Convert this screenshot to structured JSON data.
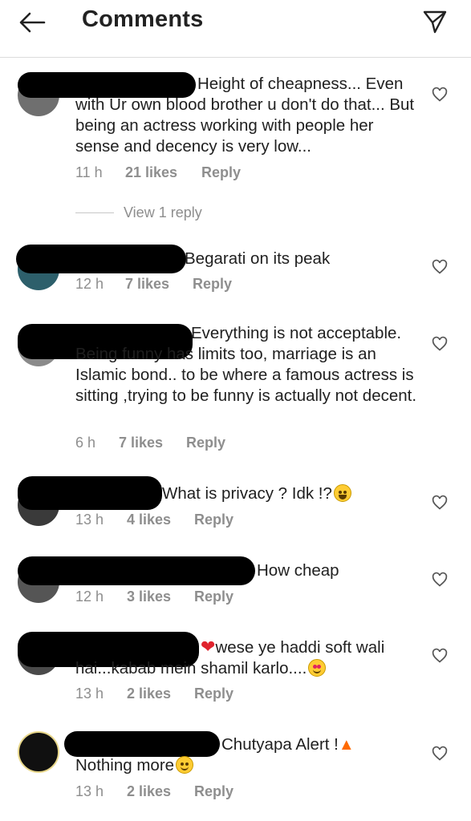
{
  "header": {
    "title": "Comments",
    "back_icon": "arrow-left-icon",
    "send_icon": "send-paper-plane-icon"
  },
  "comments": [
    {
      "text": "Height of cheapness... Even with Ur own blood brother u don't do that... But being an actress working with people her sense and decency is very low...",
      "time": "11 h",
      "likes": "21 likes",
      "reply": "Reply",
      "view_replies": "View 1 reply"
    },
    {
      "text": "Begarati on its peak",
      "time": "12 h",
      "likes": "7 likes",
      "reply": "Reply"
    },
    {
      "text": "Everything is not acceptable. Being funny has limits too, marriage is an Islamic bond.. to be where a famous actress is sitting ,trying to be funny is actually not decent.",
      "time": "6 h",
      "likes": "7 likes",
      "reply": "Reply"
    },
    {
      "text": "What is privacy ? Idk !?",
      "time": "13 h",
      "likes": "4 likes",
      "reply": "Reply"
    },
    {
      "text": "How cheap",
      "time": "12 h",
      "likes": "3 likes",
      "reply": "Reply"
    },
    {
      "text": "wese ye haddi soft wali hai...kabab mein shamil karlo....",
      "time": "13 h",
      "likes": "2 likes",
      "reply": "Reply"
    },
    {
      "text": "Chutyapa Alert !",
      "text2": "Nothing more",
      "time": "13 h",
      "likes": "2 likes",
      "reply": "Reply"
    }
  ],
  "colors": {
    "text": "#262626",
    "meta": "#8e8e8e",
    "divider": "#dbdbdb"
  }
}
